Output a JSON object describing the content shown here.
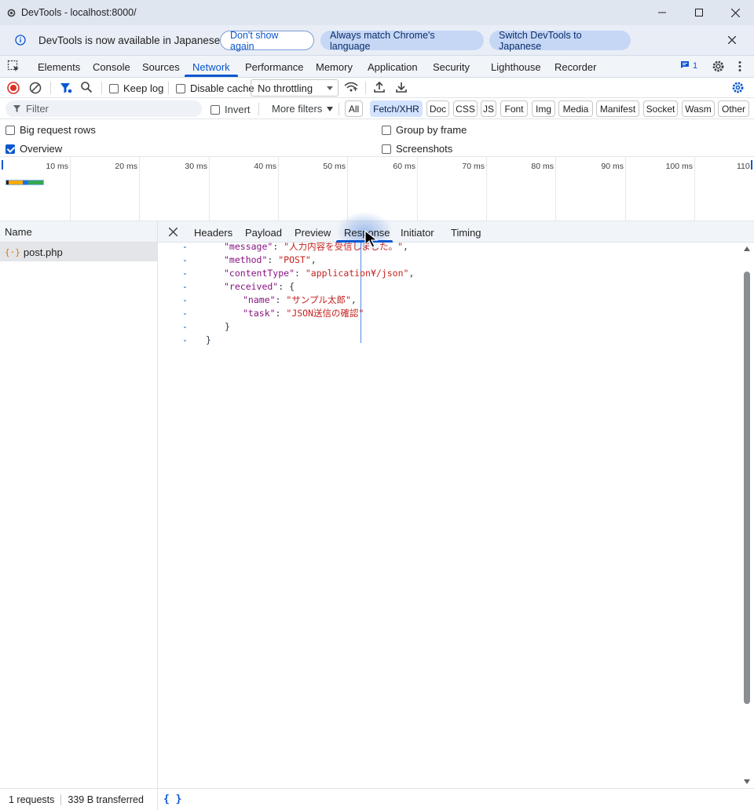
{
  "window": {
    "title": "DevTools - localhost:8000/",
    "minimize_icon": "minimize-icon",
    "maximize_icon": "maximize-icon",
    "close_icon": "close-icon"
  },
  "infobar": {
    "message": "DevTools is now available in Japanese",
    "dont_show_label": "Don't show again",
    "always_match_label": "Always match Chrome's language",
    "switch_label": "Switch DevTools to Japanese"
  },
  "main_tabs": {
    "items": [
      "Elements",
      "Console",
      "Sources",
      "Network",
      "Performance",
      "Memory",
      "Application",
      "Security",
      "Lighthouse",
      "Recorder"
    ],
    "active": "Network",
    "issues_count": "1"
  },
  "toolbar": {
    "keep_log_label": "Keep log",
    "disable_cache_label": "Disable cache",
    "throttling_value": "No throttling"
  },
  "filterbar": {
    "filter_placeholder": "Filter",
    "invert_label": "Invert",
    "more_filters_label": "More filters",
    "chips": [
      "All",
      "Fetch/XHR",
      "Doc",
      "CSS",
      "JS",
      "Font",
      "Img",
      "Media",
      "Manifest",
      "Socket",
      "Wasm",
      "Other"
    ],
    "active_chip": "Fetch/XHR"
  },
  "options": {
    "big_request_rows_label": "Big request rows",
    "overview_label": "Overview",
    "overview_checked": true,
    "group_by_frame_label": "Group by frame",
    "screenshots_label": "Screenshots"
  },
  "overview": {
    "ticks": [
      "10 ms",
      "20 ms",
      "30 ms",
      "40 ms",
      "50 ms",
      "60 ms",
      "70 ms",
      "80 ms",
      "90 ms",
      "100 ms",
      "110"
    ]
  },
  "request_list": {
    "header": "Name",
    "rows": [
      {
        "name": "post.php",
        "icon": "xhr-icon"
      }
    ]
  },
  "details": {
    "tabs": [
      "Headers",
      "Payload",
      "Preview",
      "Response",
      "Initiator",
      "Timing"
    ],
    "active_tab": "Response"
  },
  "response": {
    "lines": [
      {
        "gutter": "-",
        "parts": [
          [
            "k",
            "\"message\""
          ],
          [
            "p",
            ": "
          ],
          [
            "s",
            "\"人力内容を受信しました。\""
          ],
          [
            "p",
            ","
          ]
        ]
      },
      {
        "gutter": "-",
        "parts": [
          [
            "k",
            "\"method\""
          ],
          [
            "p",
            ": "
          ],
          [
            "s",
            "\"POST\""
          ],
          [
            "p",
            ","
          ]
        ]
      },
      {
        "gutter": "-",
        "parts": [
          [
            "k",
            "\"contentType\""
          ],
          [
            "p",
            ": "
          ],
          [
            "s",
            "\"application¥/json\""
          ],
          [
            "p",
            ","
          ]
        ]
      },
      {
        "gutter": "-",
        "parts": [
          [
            "k",
            "\"received\""
          ],
          [
            "p",
            ": {"
          ]
        ]
      },
      {
        "gutter": "-",
        "parts": [
          [
            "k",
            "\"name\""
          ],
          [
            "p",
            ": "
          ],
          [
            "s",
            "\"サンプル太郎\""
          ],
          [
            "p",
            ","
          ]
        ]
      },
      {
        "gutter": "-",
        "parts": [
          [
            "k",
            "\"task\""
          ],
          [
            "p",
            ": "
          ],
          [
            "s",
            "\"JSON送信の確認\""
          ]
        ]
      },
      {
        "gutter": "-",
        "parts": [
          [
            "p",
            "}"
          ]
        ]
      },
      {
        "gutter": "-",
        "parts": [
          [
            "p",
            "}"
          ]
        ]
      }
    ]
  },
  "status": {
    "requests": "1 requests",
    "transferred": "339 B transferred",
    "pretty_print": "{ }"
  },
  "colors": {
    "accent": "#0b57d0",
    "json_key": "#881280",
    "json_string": "#c5221f",
    "xhr_icon": "#e37400"
  }
}
